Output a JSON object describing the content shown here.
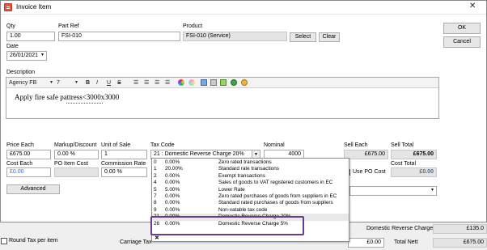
{
  "window": {
    "title": "Invoice Item",
    "close": "✕"
  },
  "side_buttons": {
    "ok": "OK",
    "cancel": "Cancel"
  },
  "fields": {
    "qty_label": "Qty",
    "qty": "1.00",
    "partref_label": "Part Ref",
    "partref": "FSI-010",
    "product_label": "Product",
    "product": "FSI-010 (Service)",
    "select": "Select",
    "clear": "Clear",
    "date_label": "Date",
    "date": "26/01/2021",
    "description_label": "Description"
  },
  "editor": {
    "font": "Agency FB",
    "size": "7",
    "bold": "B",
    "italic": "I",
    "underline": "U",
    "strike": "S",
    "text": "Apply fire safe pattress<3000x3000"
  },
  "pricing": {
    "price_each_label": "Price Each",
    "price_each": "£675.00",
    "markup_label": "Markup/Discount",
    "markup": "0.00 %",
    "unit_label": "Unit of Sale",
    "unit": "1",
    "taxcode_label": "Tax Code",
    "taxcode": "21 : Domestic Reverse Charge 20%",
    "nominal_label": "Nominal",
    "nominal": "4000",
    "sell_each_label": "Sell Each",
    "sell_each": "£675.00",
    "sell_total_label": "Sell Total",
    "sell_total": "£675.00",
    "cost_each_label": "Cost Each",
    "cost_each": "£0.00",
    "po_item_cost_label": "PO Item Cost",
    "commission_label": "Commission Rate",
    "commission": "0.00 %",
    "use_po_cost": "Use PO Cost",
    "cost_total_label": "Cost Total",
    "cost_total": "£0.00",
    "advanced": "Advanced"
  },
  "tax_options": [
    {
      "code": "0",
      "rate": "0.00%",
      "desc": "Zero rated transactions"
    },
    {
      "code": "1",
      "rate": "20.00%",
      "desc": "Standard rate transactions"
    },
    {
      "code": "2",
      "rate": "0.00%",
      "desc": "Exempt transactions"
    },
    {
      "code": "4",
      "rate": "0.00%",
      "desc": "Sales of goods to VAT registered customers in EC"
    },
    {
      "code": "5",
      "rate": "5.00%",
      "desc": "Lower Rate"
    },
    {
      "code": "7",
      "rate": "0.00%",
      "desc": "Zero rated purchases of goods from suppliers in EC"
    },
    {
      "code": "8",
      "rate": "0.00%",
      "desc": "Standard rated purchases of goods from suppliers"
    },
    {
      "code": "9",
      "rate": "0.00%",
      "desc": "Non-vatable tax code"
    },
    {
      "code": "21",
      "rate": "0.00%",
      "desc": "Domestic Reverse Charge 20%"
    },
    {
      "code": "26",
      "rate": "0.00%",
      "desc": "Domestic Reverse Charge 5%"
    }
  ],
  "bottom": {
    "round_tax": "Round Tax per item",
    "carriage_tax": "Carriage Tax",
    "domestic_rc": "Domestic Reverse Charge",
    "domestic_rc_value": "£135.0",
    "carriage_value": "£0.00",
    "total_nett_label": "Total Nett",
    "total_nett": "£675.00"
  },
  "colors": {
    "highlight": "#6b3b8f",
    "link_blue": "#3a6fc4"
  }
}
